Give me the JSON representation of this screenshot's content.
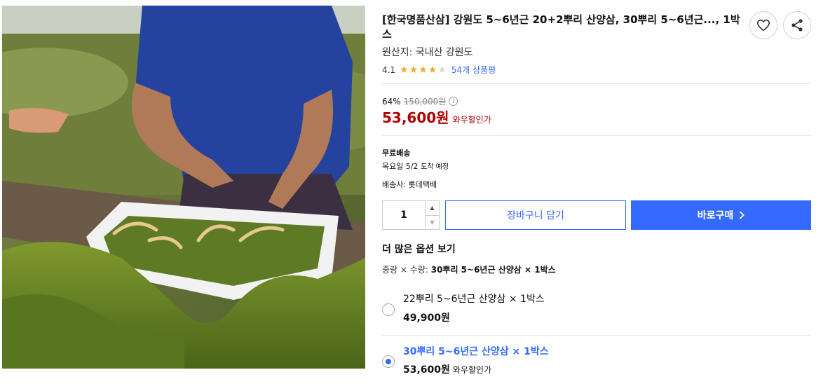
{
  "product": {
    "title": "[한국명품산삼] 강원도 5~6년근 20+2뿌리 산양삼, 30뿌리 5~6년근..., 1박스",
    "origin": "원산지: 국내산 강원도",
    "rating": "4.1",
    "rating_stars": 4,
    "review_count": "54개 상품평"
  },
  "price": {
    "discount": "64%",
    "original": "150,000원",
    "info_icon": "ⓘ",
    "sale": "53,600원",
    "tag": "와우할인가"
  },
  "shipping": {
    "type": "무료배송",
    "date": "목요일 5/2",
    "date_suffix": "도착 예정",
    "carrier": "배송사: 롯데택배"
  },
  "actions": {
    "quantity": "1",
    "add_to_cart": "장바구니 담기",
    "buy_now": "바로구매"
  },
  "options": {
    "title": "더 많은 옵션 보기",
    "summary_label": "중량 × 수량:",
    "summary_value": "30뿌리 5~6년근 산양삼 × 1박스",
    "items": [
      {
        "name": "22뿌리 5~6년근 산양삼 × 1박스",
        "price": "49,900원",
        "tag": "",
        "selected": false
      },
      {
        "name": "30뿌리 5~6년근 산양삼 × 1박스",
        "price": "53,600원",
        "tag": "와우할인가",
        "selected": true
      }
    ]
  },
  "icons": {
    "wishlist": "heart-icon",
    "share": "share-icon"
  },
  "colors": {
    "accent": "#346aff",
    "price_red": "#ae0000",
    "star": "#f5a623"
  }
}
